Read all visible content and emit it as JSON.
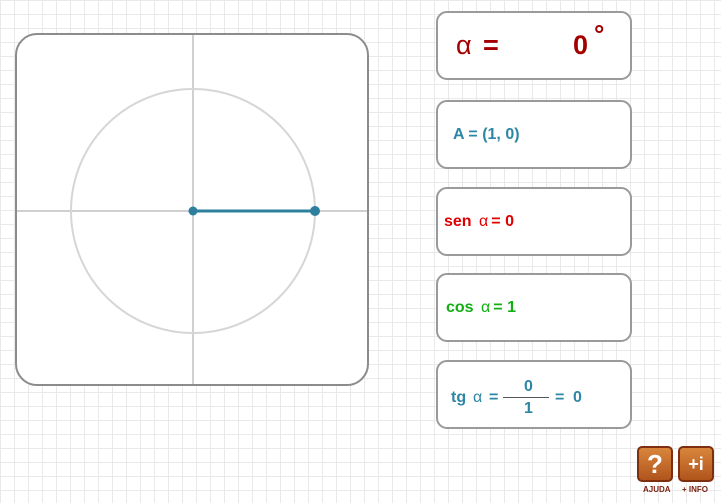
{
  "angle": {
    "symbol": "α",
    "equals": "=",
    "value": "0",
    "degree_symbol": "°"
  },
  "point": {
    "text": "A = (1, 0)"
  },
  "sine": {
    "name": "sen",
    "symbol": "α",
    "equals": "=",
    "value": "0"
  },
  "cosine": {
    "name": "cos",
    "symbol": "α",
    "equals": "=",
    "value": "1"
  },
  "tangent": {
    "name": "tg",
    "symbol": "α",
    "equals": "=",
    "numerator": "0",
    "denominator": "1",
    "equals2": "=",
    "value": "0"
  },
  "buttons": {
    "help_glyph": "?",
    "help_label": "AJUDA",
    "info_glyph": "+i",
    "info_label": "+ INFO"
  },
  "unit_circle": {
    "angle_degrees": 0,
    "point_x": 1,
    "point_y": 0
  },
  "colors": {
    "angle": "#a30000",
    "sine": "#e00000",
    "cosine": "#12b012",
    "tangent": "#2e86a6",
    "radius_line": "#2e7f9e",
    "circle": "#d6d6d6",
    "axes": "#d0d0d0"
  }
}
